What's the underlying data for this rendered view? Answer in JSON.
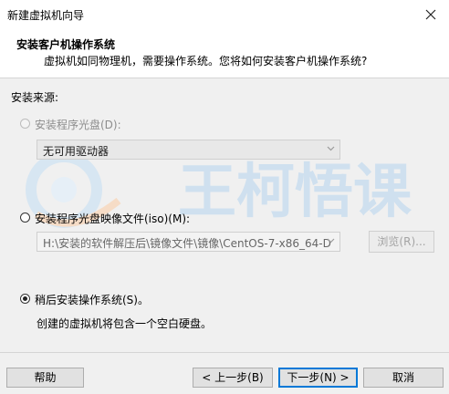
{
  "window": {
    "title": "新建虚拟机向导"
  },
  "header": {
    "title": "安装客户机操作系统",
    "subtitle": "虚拟机如同物理机，需要操作系统。您将如何安装客户机操作系统?"
  },
  "install_source_label": "安装来源:",
  "options": {
    "disc": {
      "label": "安装程序光盘(D):",
      "selected": false,
      "enabled": false,
      "drive_value": "无可用驱动器"
    },
    "iso": {
      "label": "安装程序光盘映像文件(iso)(M):",
      "selected": false,
      "path_value": "H:\\安装的软件解压后\\镜像文件\\镜像\\CentOS-7-x86_64-D",
      "browse_label": "浏览(R)..."
    },
    "later": {
      "label": "稍后安装操作系统(S)。",
      "selected": true,
      "description": "创建的虚拟机将包含一个空白硬盘。"
    }
  },
  "watermark": {
    "text": "王柯悟课",
    "color": "#cfe0ef"
  },
  "footer": {
    "help": "帮助",
    "back": "< 上一步(B)",
    "next": "下一步(N) >",
    "cancel": "取消"
  },
  "colors": {
    "accent": "#0078d7",
    "disabled": "#8d8d8d"
  }
}
